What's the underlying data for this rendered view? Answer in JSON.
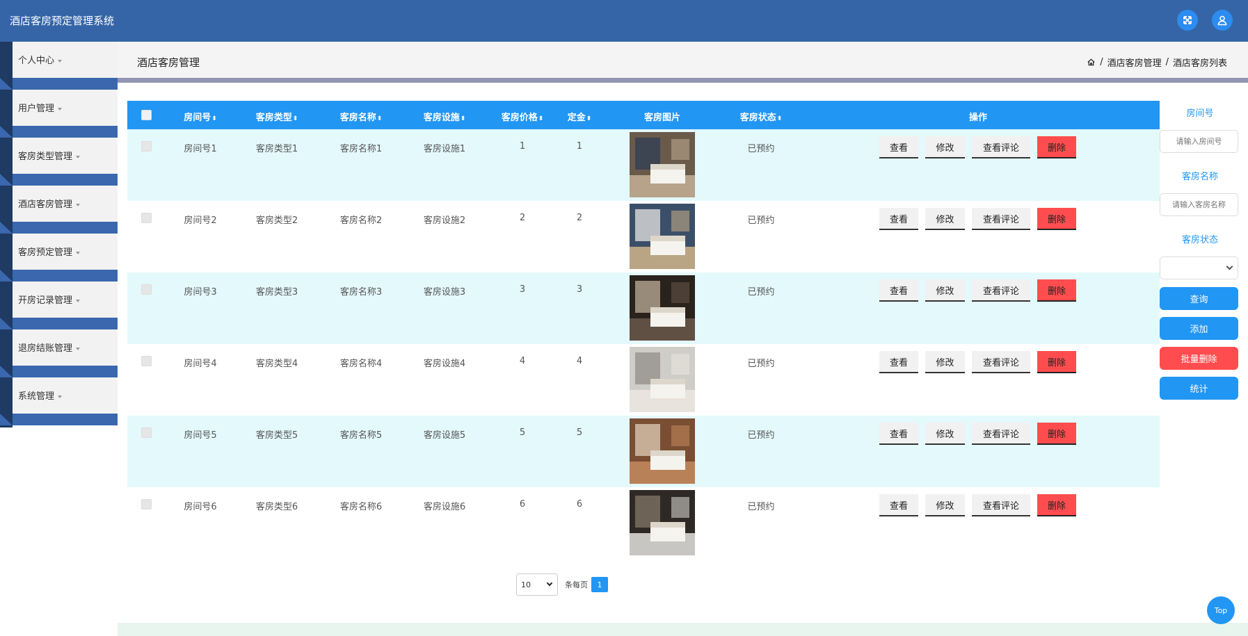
{
  "app": {
    "title": "酒店客房预定管理系统"
  },
  "sidebar": {
    "items": [
      {
        "label": "个人中心"
      },
      {
        "label": "用户管理"
      },
      {
        "label": "客房类型管理"
      },
      {
        "label": "酒店客房管理"
      },
      {
        "label": "客房预定管理"
      },
      {
        "label": "开房记录管理"
      },
      {
        "label": "退房结账管理"
      },
      {
        "label": "系统管理"
      }
    ]
  },
  "header": {
    "title": "酒店客房管理",
    "breadcrumb": [
      "酒店客房管理",
      "酒店客房列表"
    ],
    "separator": "/"
  },
  "table": {
    "columns": [
      "房间号",
      "客房类型",
      "客房名称",
      "客房设施",
      "客房价格",
      "定金",
      "客房图片",
      "客房状态",
      "操作"
    ],
    "sort_glyph": "⬍",
    "rows": [
      {
        "room_no": "房间号1",
        "type": "客房类型1",
        "name": "客房名称1",
        "facility": "客房设施1",
        "price": "1",
        "deposit": "1",
        "status": "已预约"
      },
      {
        "room_no": "房间号2",
        "type": "客房类型2",
        "name": "客房名称2",
        "facility": "客房设施2",
        "price": "2",
        "deposit": "2",
        "status": "已预约"
      },
      {
        "room_no": "房间号3",
        "type": "客房类型3",
        "name": "客房名称3",
        "facility": "客房设施3",
        "price": "3",
        "deposit": "3",
        "status": "已预约"
      },
      {
        "room_no": "房间号4",
        "type": "客房类型4",
        "name": "客房名称4",
        "facility": "客房设施4",
        "price": "4",
        "deposit": "4",
        "status": "已预约"
      },
      {
        "room_no": "房间号5",
        "type": "客房类型5",
        "name": "客房名称5",
        "facility": "客房设施5",
        "price": "5",
        "deposit": "5",
        "status": "已预约"
      },
      {
        "room_no": "房间号6",
        "type": "客房类型6",
        "name": "客房名称6",
        "facility": "客房设施6",
        "price": "6",
        "deposit": "6",
        "status": "已预约"
      }
    ],
    "actions": {
      "view": "查看",
      "edit": "修改",
      "comments": "查看评论",
      "delete": "删除"
    }
  },
  "search": {
    "room_no_label": "房间号",
    "room_no_placeholder": "请输入房间号",
    "name_label": "客房名称",
    "name_placeholder": "请输入客房名称",
    "status_label": "客房状态",
    "status_value": "",
    "query_button": "查询",
    "add_button": "添加",
    "batch_delete_button": "批量删除",
    "stats_button": "统计"
  },
  "pagination": {
    "page_size": "10",
    "per_page_label": "条每页",
    "current_page": "1"
  },
  "top_button": "Top",
  "colors": {
    "topbar": "#3565a7",
    "table_header": "#2196f3",
    "row_alt": "#e4f9fb",
    "delete": "#ff4d4f",
    "accent": "#2196f3"
  }
}
